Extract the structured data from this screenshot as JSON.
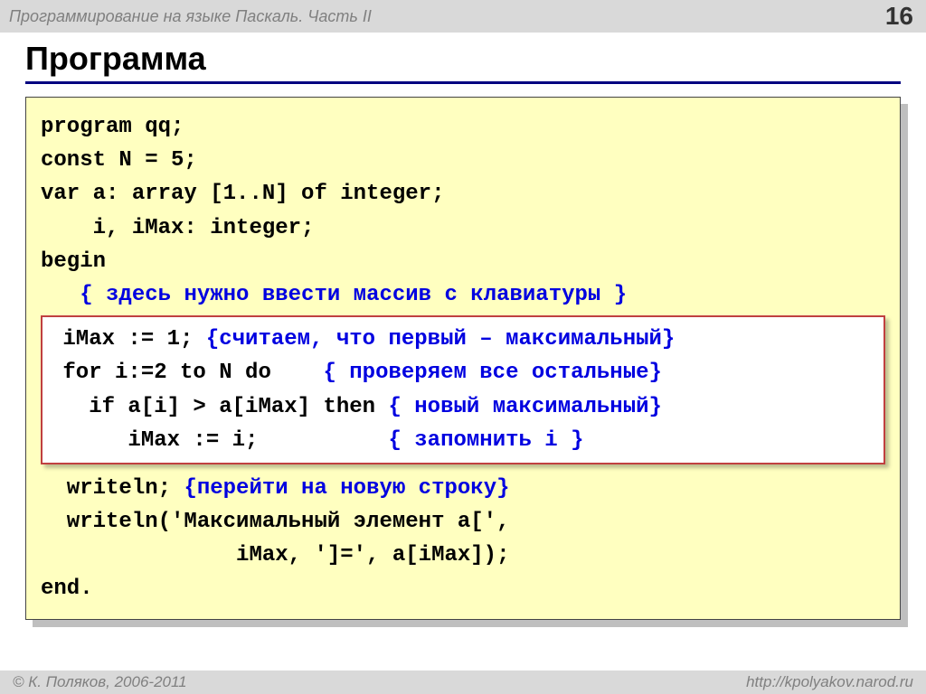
{
  "topbar": {
    "title": "Программирование на языке Паскаль. Часть II",
    "page": "16"
  },
  "heading": "Программа",
  "code": {
    "l1": "program qq;",
    "l2": "const N = 5;",
    "l3": "var a: array [1..N] of integer;",
    "l4": "    i, iMax: integer;",
    "l5": "begin",
    "l6a": "   ",
    "l6b": "{ здесь нужно ввести массив с клавиатуры }",
    "b1a": " iMax := 1; ",
    "b1b": "{считаем, что первый – максимальный}",
    "b2a": " for i:=2 to N do    ",
    "b2b": "{ проверяем все остальные}",
    "b3a": "   if a[i] > a[iMax] then ",
    "b3b": "{ новый максимальный}",
    "b4a": "      iMax := i;          ",
    "b4b": "{ запомнить i }",
    "l7a": "  writeln; ",
    "l7b": "{перейти на новую строку}",
    "l8": "  writeln('Максимальный элемент a[',",
    "l9": "               iMax, ']=', a[iMax]);",
    "l10": "end."
  },
  "footer": {
    "copyright": "© К. Поляков, 2006-2011",
    "url": "http://kpolyakov.narod.ru"
  }
}
